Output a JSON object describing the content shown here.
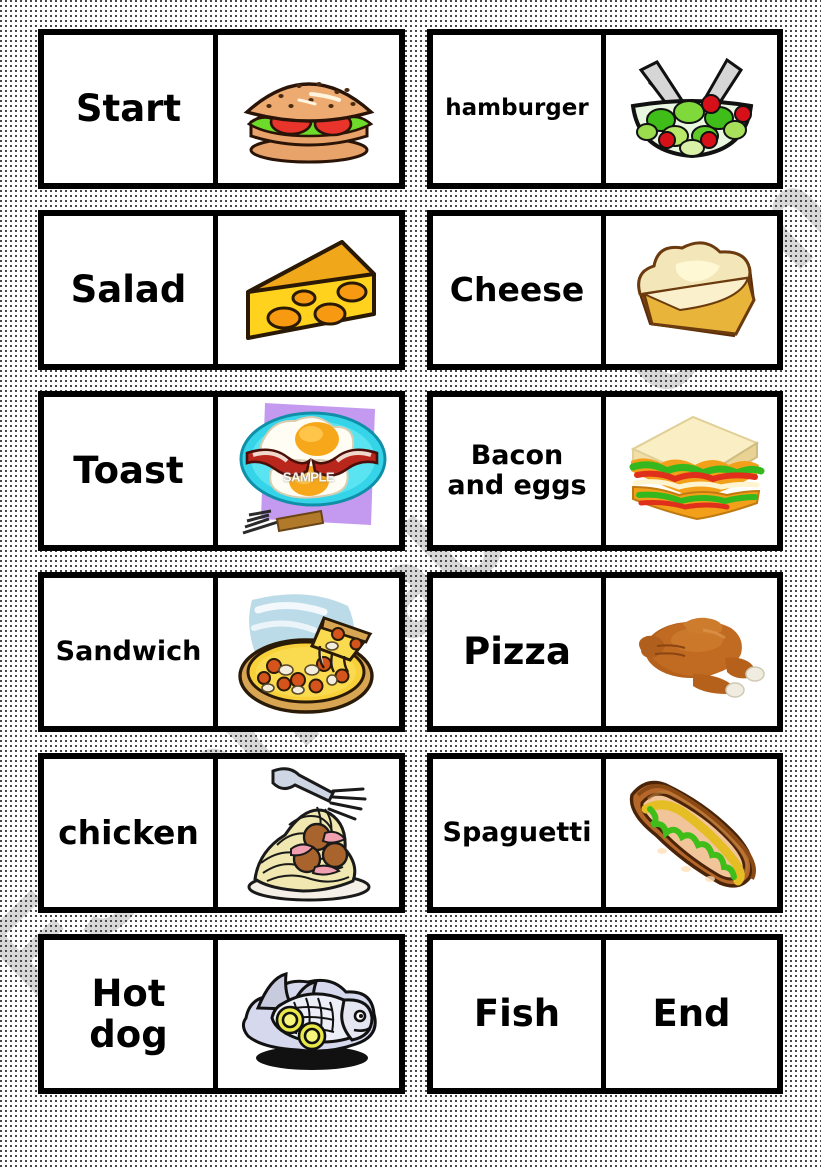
{
  "page": {
    "background_color": "#ffffff",
    "dot_color": "#1a1a1a",
    "border_color": "#000000"
  },
  "watermark": {
    "text": "ESLprintables.com",
    "color": "#5a5a5a"
  },
  "sample_stamp": {
    "text": "SAMPLE"
  },
  "dominoes": [
    {
      "id": "domino-1",
      "column": "left",
      "row": 1,
      "word": "Start",
      "word_size": "sz-xl",
      "picture": "hamburger-image",
      "picture_label": "hamburger"
    },
    {
      "id": "domino-2",
      "column": "right",
      "row": 1,
      "word": "hamburger",
      "word_size": "sz-sm",
      "picture": "salad-bowl-image",
      "picture_label": "salad"
    },
    {
      "id": "domino-3",
      "column": "left",
      "row": 2,
      "word": "Salad",
      "word_size": "sz-xl",
      "picture": "cheese-wedge-image",
      "picture_label": "cheese"
    },
    {
      "id": "domino-4",
      "column": "right",
      "row": 2,
      "word": "Cheese",
      "word_size": "sz-lg",
      "picture": "toast-image",
      "picture_label": "toast"
    },
    {
      "id": "domino-5",
      "column": "left",
      "row": 3,
      "word": "Toast",
      "word_size": "sz-xl",
      "picture": "bacon-and-eggs-image",
      "picture_label": "bacon and eggs"
    },
    {
      "id": "domino-6",
      "column": "right",
      "row": 3,
      "word": "Bacon and eggs",
      "word_size": "sz-md",
      "picture": "sandwich-image",
      "picture_label": "sandwich"
    },
    {
      "id": "domino-7",
      "column": "left",
      "row": 4,
      "word": "Sandwich",
      "word_size": "sz-md",
      "picture": "pizza-image",
      "picture_label": "pizza"
    },
    {
      "id": "domino-8",
      "column": "right",
      "row": 4,
      "word": "Pizza",
      "word_size": "sz-xl",
      "picture": "roast-chicken-image",
      "picture_label": "chicken"
    },
    {
      "id": "domino-9",
      "column": "left",
      "row": 5,
      "word": "chicken",
      "word_size": "sz-lg",
      "picture": "spaghetti-image",
      "picture_label": "spaguetti"
    },
    {
      "id": "domino-10",
      "column": "right",
      "row": 5,
      "word": "Spaguetti",
      "word_size": "sz-md",
      "picture": "hot-dog-image",
      "picture_label": "hot dog"
    },
    {
      "id": "domino-11",
      "column": "left",
      "row": 6,
      "word": "Hot dog",
      "word_size": "sz-xl",
      "picture": "fish-image",
      "picture_label": "fish"
    },
    {
      "id": "domino-12",
      "column": "right",
      "row": 6,
      "word": "Fish",
      "word_size": "sz-xl",
      "word2": "End",
      "word2_size": "sz-xl",
      "picture": null,
      "picture_label": null
    }
  ]
}
